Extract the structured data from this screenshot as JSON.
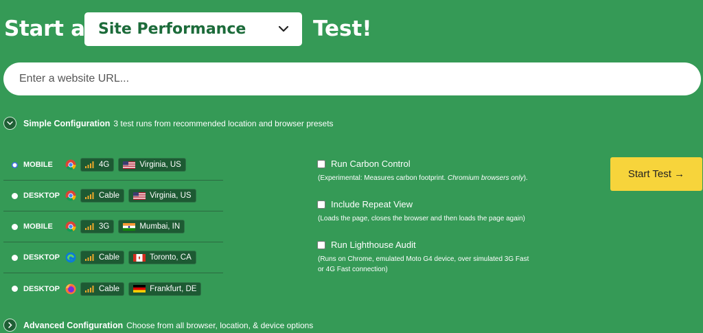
{
  "header": {
    "prefix": "Start a",
    "test_type": "Site Performance",
    "suffix": "Test!"
  },
  "url": {
    "placeholder": "Enter a website URL..."
  },
  "simple_config": {
    "title": "Simple Configuration",
    "description": "3 test runs from recommended location and browser presets"
  },
  "presets": [
    {
      "device": "MOBILE",
      "browser": "chrome",
      "connection": "4G",
      "location": "Virginia, US",
      "flag": "us",
      "selected": true
    },
    {
      "device": "DESKTOP",
      "browser": "chrome",
      "connection": "Cable",
      "location": "Virginia, US",
      "flag": "us",
      "selected": false
    },
    {
      "device": "MOBILE",
      "browser": "chrome",
      "connection": "3G",
      "location": "Mumbai, IN",
      "flag": "in",
      "selected": false
    },
    {
      "device": "DESKTOP",
      "browser": "edge",
      "connection": "Cable",
      "location": "Toronto, CA",
      "flag": "ca",
      "selected": false
    },
    {
      "device": "DESKTOP",
      "browser": "firefox",
      "connection": "Cable",
      "location": "Frankfurt, DE",
      "flag": "de",
      "selected": false
    }
  ],
  "options": {
    "carbon": {
      "label": "Run Carbon Control",
      "desc_plain": "(Experimental: Measures carbon footprint. ",
      "desc_italic": "Chromium browsers only",
      "desc_end": ")."
    },
    "repeat": {
      "label": "Include Repeat View",
      "desc": "(Loads the page, closes the browser and then loads the page again)"
    },
    "lighthouse": {
      "label": "Run Lighthouse Audit",
      "desc_line1": "(Runs on Chrome, emulated Moto G4 device, over simulated 3G Fast",
      "desc_line2": "or 4G Fast connection)"
    }
  },
  "start_button": "Start Test →",
  "advanced_config": {
    "title": "Advanced Configuration",
    "description": "Choose from all browser, location, & device options"
  },
  "colors": {
    "background": "#359a56",
    "accent": "#f7d43b",
    "tag_bg": "#1d5a33"
  }
}
